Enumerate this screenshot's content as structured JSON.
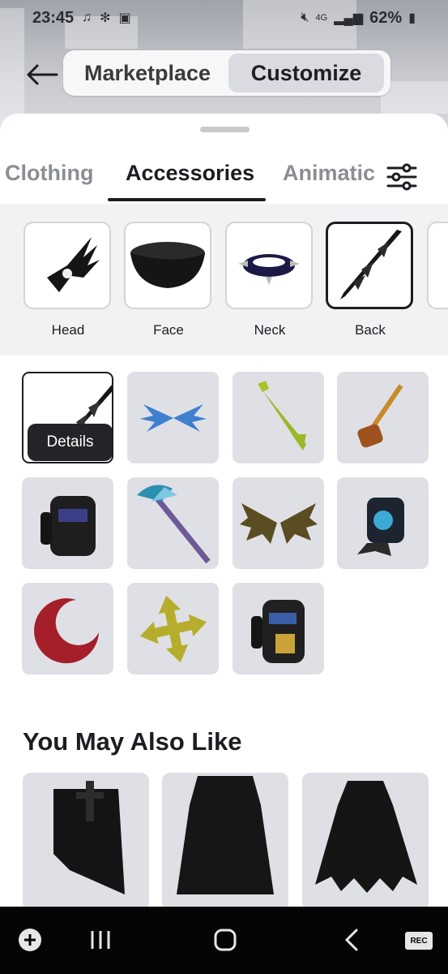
{
  "status_bar": {
    "time": "23:45",
    "network": "4G",
    "battery": "62%",
    "left_icons": [
      "music-note-icon",
      "bug-icon",
      "image-icon"
    ],
    "right_icons": [
      "mute-icon",
      "signal-icon",
      "battery-icon"
    ]
  },
  "header": {
    "back_icon": "arrow-left-icon",
    "segments": [
      {
        "label": "Marketplace",
        "selected": false
      },
      {
        "label": "Customize",
        "selected": true
      }
    ]
  },
  "tabs": {
    "items": [
      {
        "label": "Clothing",
        "selected": false
      },
      {
        "label": "Accessories",
        "selected": true
      },
      {
        "label": "Animatic",
        "selected": false
      }
    ],
    "filter_icon": "sliders-icon"
  },
  "subcategories": [
    {
      "label": "Head",
      "selected": false
    },
    {
      "label": "Face",
      "selected": false
    },
    {
      "label": "Neck",
      "selected": false
    },
    {
      "label": "Back",
      "selected": true
    }
  ],
  "items": {
    "details_label": "Details",
    "count": 11
  },
  "also_like": {
    "title": "You May Also Like"
  },
  "nav_bar": {
    "icons": [
      "game-icon",
      "recents-icon",
      "home-icon",
      "back-icon",
      "record-icon"
    ],
    "record_label": "REC"
  },
  "colors": {
    "accent_dark": "#1b1d22",
    "tile_bg": "#dfe0e6",
    "selected_segment": "#d9dbe1"
  }
}
